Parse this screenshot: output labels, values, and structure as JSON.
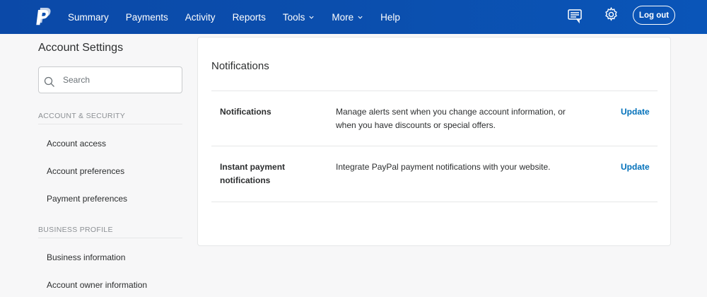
{
  "header": {
    "nav": [
      {
        "label": "Summary"
      },
      {
        "label": "Payments"
      },
      {
        "label": "Activity"
      },
      {
        "label": "Reports"
      },
      {
        "label": "Tools",
        "dropdown": true
      },
      {
        "label": "More",
        "dropdown": true
      },
      {
        "label": "Help"
      }
    ],
    "logout_label": "Log out",
    "icons": [
      "paypal-logo-icon",
      "message-center-icon",
      "gear-icon"
    ],
    "bg_color": "#0b4fae"
  },
  "sidebar": {
    "title": "Account Settings",
    "search_placeholder": "Search",
    "sections": [
      {
        "heading": "ACCOUNT & SECURITY",
        "items": [
          "Account access",
          "Account preferences",
          "Payment preferences"
        ]
      },
      {
        "heading": "BUSINESS PROFILE",
        "items": [
          "Business information",
          "Account owner information"
        ]
      }
    ]
  },
  "main": {
    "title": "Notifications",
    "rows": [
      {
        "name": "Notifications",
        "description": "Manage alerts sent when you change account information, or when you have discounts or special offers.",
        "action": "Update"
      },
      {
        "name": "Instant payment notifications",
        "description": "Integrate PayPal payment notifications with your website.",
        "action": "Update"
      }
    ],
    "link_color": "#0070ba"
  }
}
